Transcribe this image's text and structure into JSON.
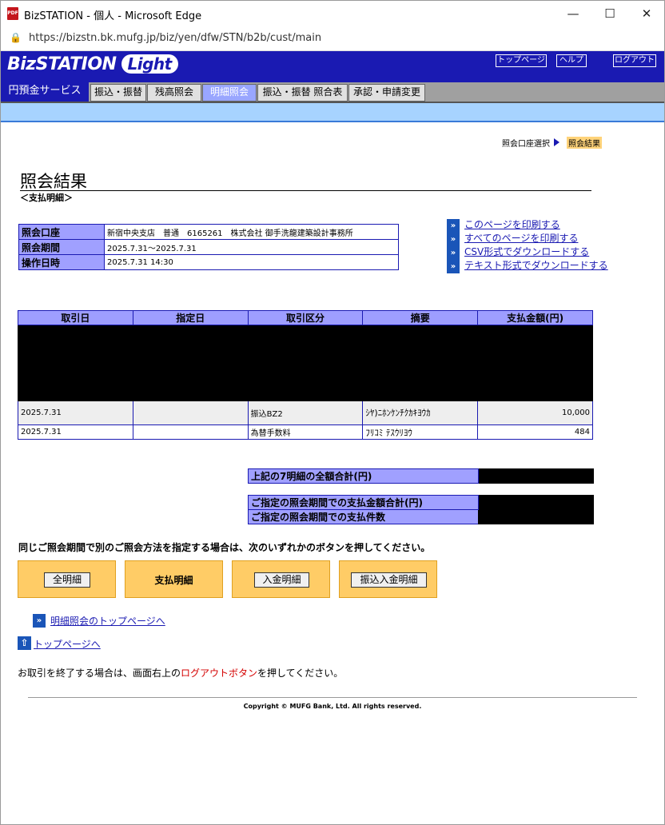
{
  "window": {
    "title": "BizSTATION - 個人 - Microsoft Edge",
    "url": "https://bizstn.bk.mufg.jp/biz/yen/dfw/STN/b2b/cust/main"
  },
  "header": {
    "logo_main": "BizSTATION",
    "logo_light": "Light",
    "top_page": "トップページ",
    "help": "ヘルプ",
    "logout": "ログアウト"
  },
  "nav": {
    "section": "円預金サービス",
    "tabs": [
      "振込・振替",
      "残高照会",
      "明細照会",
      "振込・振替 照合表",
      "承認・申請変更"
    ],
    "active_tab": "明細照会"
  },
  "breadcrumb": {
    "step1": "照会口座選択",
    "step2": "照会結果"
  },
  "page": {
    "title": "照会結果",
    "subtitle": "＜支払明細＞"
  },
  "account_info": {
    "labels": [
      "照会口座",
      "照会期間",
      "操作日時"
    ],
    "account": "新宿中央支店　普通　6165261　株式会社 御手洗龍建築設計事務所",
    "period": "2025.7.31〜2025.7.31",
    "operated": "2025.7.31 14:30"
  },
  "side_links": [
    "このページを印刷する",
    "すべてのページを印刷する",
    "CSV形式でダウンロードする",
    "テキスト形式でダウンロードする"
  ],
  "transactions": {
    "columns": [
      "取引日",
      "指定日",
      "取引区分",
      "摘要",
      "支払金額(円)"
    ],
    "rows": [
      {
        "date": "2025.7.31",
        "designated": "",
        "type": "振込BZ2",
        "memo": "ｼﾔ)ﾆﾎﾝｹﾝﾁｸｶｷﾖｳｶ",
        "amount": "10,000"
      },
      {
        "date": "2025.7.31",
        "designated": "",
        "type": "為替手数料",
        "memo": "ﾌﾘｺﾐ ﾃｽｳﾘﾖｳ",
        "amount": "484"
      }
    ]
  },
  "totals": {
    "sum_label": "上記の7明細の全額合計(円)",
    "period_total_label": "ご指定の照会期間での支払金額合計(円)",
    "period_count_label": "ご指定の照会期間での支払件数"
  },
  "options": {
    "instruction": "同じご照会期間で別のご照会方法を指定する場合は、次のいずれかのボタンを押してください。",
    "all": "全明細",
    "payment": "支払明細",
    "deposit": "入金明細",
    "transfer": "振込入金明細"
  },
  "footer": {
    "detail_top": "明細照会のトップページへ",
    "top_page": "トップページへ",
    "end_pre": "お取引を終了する場合は、画面右上の",
    "end_red": "ログアウトボタン",
    "end_post": "を押してください。",
    "copyright": "Copyright © MUFG Bank, Ltd. All rights reserved."
  }
}
